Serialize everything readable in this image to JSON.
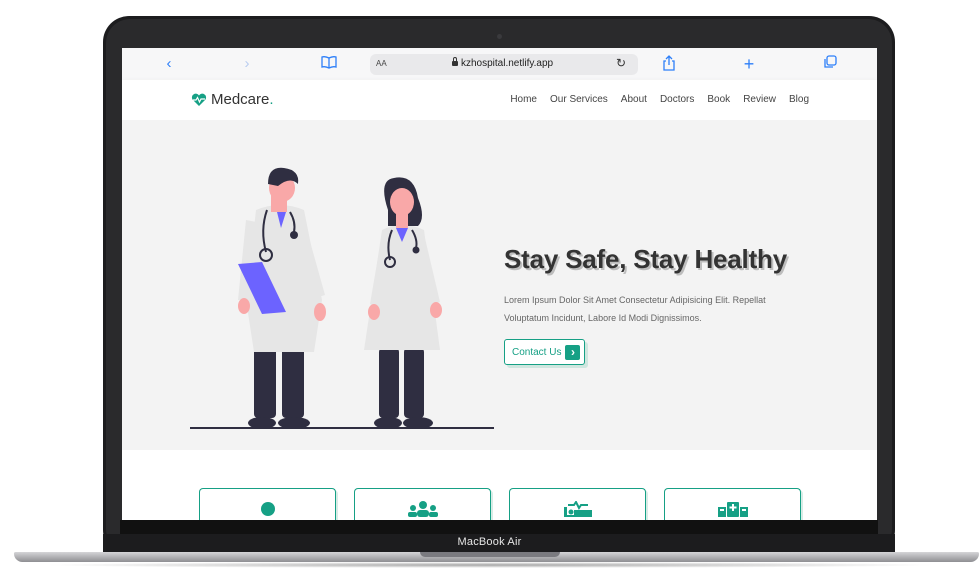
{
  "device": {
    "label": "MacBook Air"
  },
  "browser": {
    "text_size_label": "AA",
    "url": "kzhospital.netlify.app"
  },
  "site": {
    "logo": {
      "name": "Medcare",
      "dot": "."
    },
    "nav": [
      "Home",
      "Our Services",
      "About",
      "Doctors",
      "Book",
      "Review",
      "Blog"
    ]
  },
  "hero": {
    "title": "Stay Safe, Stay Healthy",
    "text": "Lorem Ipsum Dolor Sit Amet Consectetur Adipisicing Elit. Repellat Voluptatum Incidunt, Labore Id Modi Dignissimos.",
    "button_label": "Contact Us"
  },
  "service_cards": [
    {
      "icon": "user-md-icon"
    },
    {
      "icon": "users-icon"
    },
    {
      "icon": "procedures-icon"
    },
    {
      "icon": "hospital-icon"
    }
  ],
  "colors": {
    "accent": "#16a085",
    "hero_bg": "#f3f3f3",
    "browser_blue": "#2d7ff9",
    "coat_accent": "#6c63ff"
  }
}
